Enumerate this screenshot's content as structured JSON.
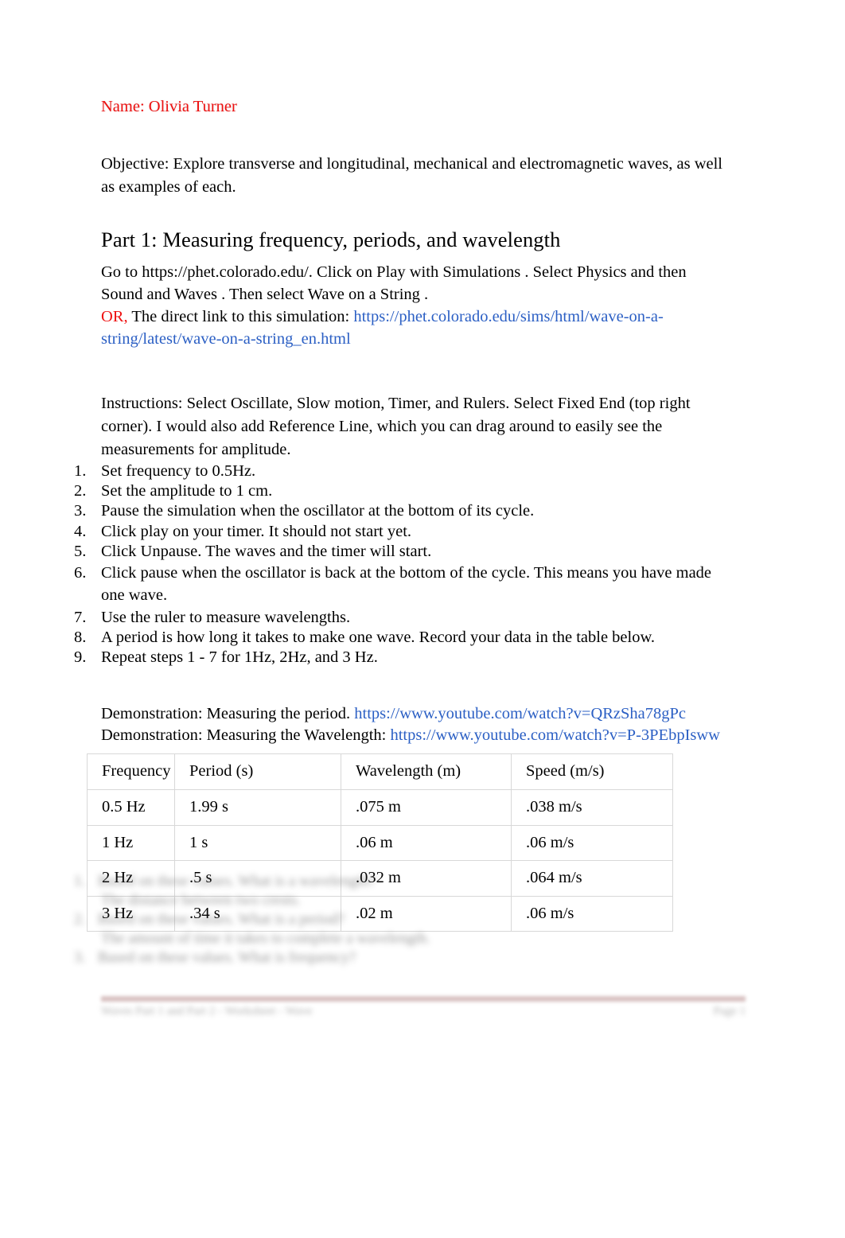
{
  "document": {
    "name_line": "Name: Olivia Turner",
    "objective": "Objective: Explore transverse and longitudinal, mechanical and electromagnetic waves, as well as examples of each.",
    "part1_heading": "Part 1: Measuring frequency, periods, and wavelength",
    "goto": {
      "sentence1": "Go to https://phet.colorado.edu/. Click on Play with Simulations  . Select Physics  and then Sound and Waves  . Then select Wave on a String  .",
      "or_label": "OR,",
      "direct_prefix": " The direct link to this simulation: ",
      "direct_link": "https://phet.colorado.edu/sims/html/wave-on-a-string/latest/wave-on-a-string_en.html"
    },
    "instructions": "Instructions:   Select Oscillate, Slow motion, Timer, and Rulers. Select Fixed End (top right corner). I would also add Reference Line, which you can drag around to easily see the measurements for amplitude.",
    "steps": [
      "Set frequency to 0.5Hz.",
      "Set the amplitude to 1 cm.",
      "Pause the simulation when the oscillator at the bottom of its cycle.",
      "Click play on your timer. It should not start yet.",
      "Click Unpause. The waves and the timer will start.",
      "Click pause when the oscillator is back at the bottom of the cycle. This means you have made one wave.",
      "Use the ruler to measure wavelengths.",
      "A period is how long it takes to make one wave.  Record your data in the table below.",
      "Repeat steps 1 - 7 for 1Hz, 2Hz, and 3 Hz."
    ],
    "demonstrations": [
      {
        "label": "Demonstration: Measuring the period. ",
        "link": "https://www.youtube.com/watch?v=QRzSha78gPc"
      },
      {
        "label": "Demonstration: Measuring the Wavelength: ",
        "link": "https://www.youtube.com/watch?v=P-3PEbpIsww"
      }
    ],
    "colors": {
      "name_red": "#ee1111",
      "link_blue": "#2b5fc4",
      "footer_rule": "#c9aaaa",
      "table_border": "#d8d8d8"
    }
  },
  "chart_data": {
    "type": "table",
    "title": "Frequency / Period / Wavelength / Speed data table",
    "columns": [
      "Frequency",
      "Period (s)",
      "Wavelength (m)",
      "Speed (m/s)"
    ],
    "rows": [
      [
        "0.5 Hz",
        "1.99 s",
        ".075 m",
        ".038 m/s"
      ],
      [
        "1 Hz",
        "1 s",
        ".06 m",
        ".06 m/s"
      ],
      [
        "2 Hz",
        ".5 s",
        ".032 m",
        ".064 m/s"
      ],
      [
        "3 Hz",
        ".34 s",
        ".02 m",
        ".06 m/s"
      ]
    ]
  },
  "redacted": {
    "lines": [
      {
        "num": "1.",
        "text": "Based on these values. What is a wavelength?",
        "indent": false
      },
      {
        "num": "",
        "text": "The distance between two crests.",
        "indent": true
      },
      {
        "num": "2.",
        "text": "Based on these values. What is a period?",
        "indent": false
      },
      {
        "num": "",
        "text": "The amount of time it takes to complete a wavelength.",
        "indent": true
      },
      {
        "num": "3.",
        "text": "Based on these values. What is frequency?",
        "indent": false
      }
    ]
  },
  "footer": {
    "left": "Waves Part 1 and Part 2  -  Worksheet  -  Wave",
    "right": "Page 1"
  }
}
